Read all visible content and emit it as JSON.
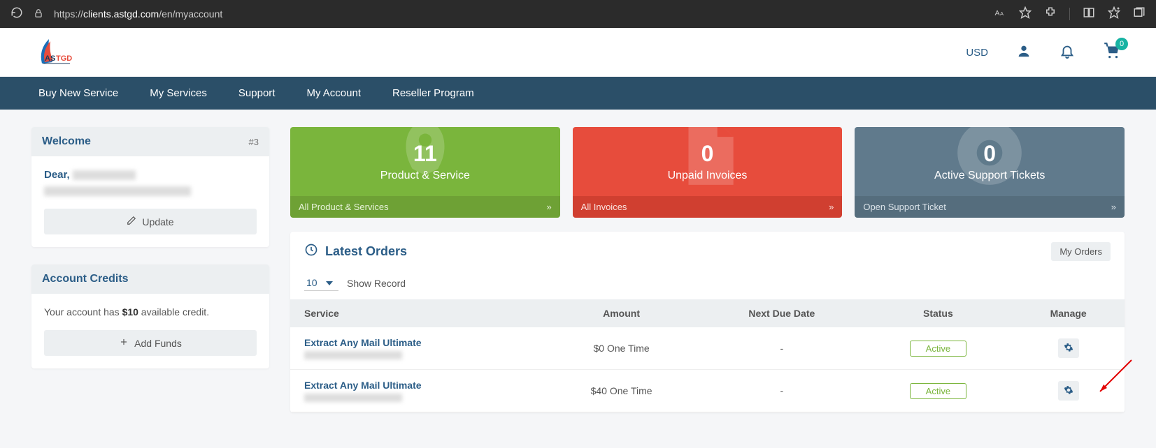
{
  "browser": {
    "url_prefix": "https://",
    "url_domain": "clients.astgd.com",
    "url_path": "/en/myaccount"
  },
  "header": {
    "currency": "USD",
    "cart_count": "0"
  },
  "nav": {
    "buy": "Buy New Service",
    "my_services": "My Services",
    "support": "Support",
    "my_account": "My Account",
    "reseller": "Reseller Program"
  },
  "welcome": {
    "title": "Welcome",
    "tab_id": "#3",
    "dear": "Dear, ",
    "update_btn": "Update"
  },
  "credits": {
    "title": "Account Credits",
    "text_pre": "Your account has ",
    "text_amount": "$10",
    "text_post": " available credit.",
    "add_funds_btn": "Add Funds"
  },
  "tiles": {
    "green": {
      "num": "11",
      "label": "Product & Service",
      "foot": "All Product & Services",
      "arrow": "»"
    },
    "red": {
      "num": "0",
      "label": "Unpaid Invoices",
      "foot": "All Invoices",
      "arrow": "»"
    },
    "gray": {
      "num": "0",
      "label": "Active Support Tickets",
      "foot": "Open Support Ticket",
      "arrow": "»"
    }
  },
  "orders": {
    "title": "Latest Orders",
    "my_orders_btn": "My Orders",
    "show_value": "10",
    "show_label": "Show Record",
    "columns": {
      "service": "Service",
      "amount": "Amount",
      "due": "Next Due Date",
      "status": "Status",
      "manage": "Manage"
    },
    "rows": [
      {
        "name": "Extract Any Mail Ultimate",
        "amount": "$0 One Time",
        "due": "-",
        "status": "Active"
      },
      {
        "name": "Extract Any Mail Ultimate",
        "amount": "$40 One Time",
        "due": "-",
        "status": "Active"
      }
    ]
  }
}
